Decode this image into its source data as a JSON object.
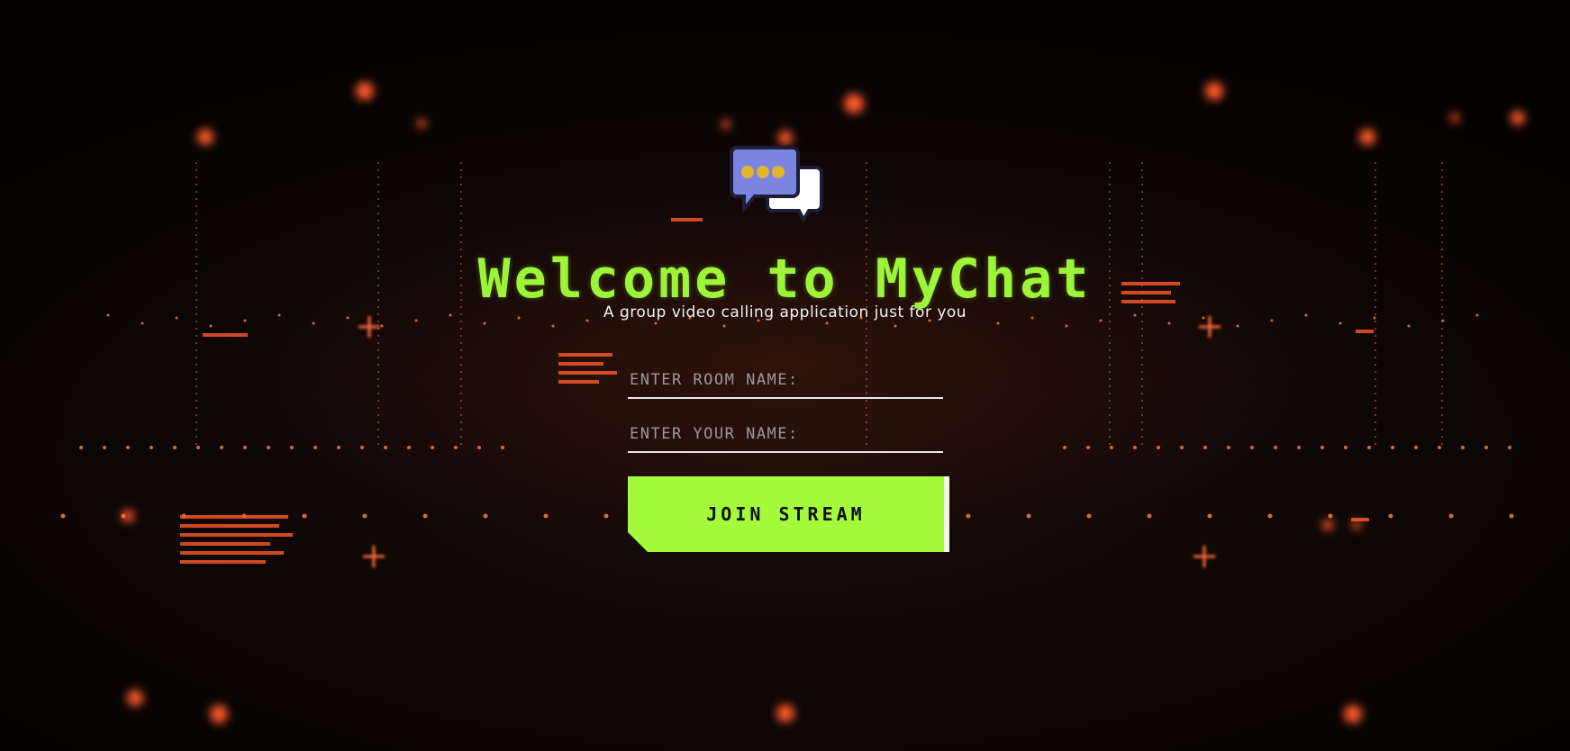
{
  "page": {
    "title": "Welcome to MyChat",
    "subtitle": "A group video calling application just for you"
  },
  "logo": {
    "icon": "chat-bubbles-icon",
    "colors": {
      "front_bubble": "#7b84e0",
      "dots": "#e3b52c",
      "back_bubble": "#ffffff",
      "outline": "#1d1d3a"
    }
  },
  "form": {
    "room_name": {
      "placeholder": "ENTER ROOM NAME:",
      "value": ""
    },
    "user_name": {
      "placeholder": "ENTER YOUR NAME:",
      "value": ""
    },
    "join_label": "JOIN STREAM"
  },
  "theme": {
    "accent": "#a4fb3c",
    "title_color": "#9df53a",
    "background": "#0b0605",
    "glow": "#ff5a2a"
  }
}
